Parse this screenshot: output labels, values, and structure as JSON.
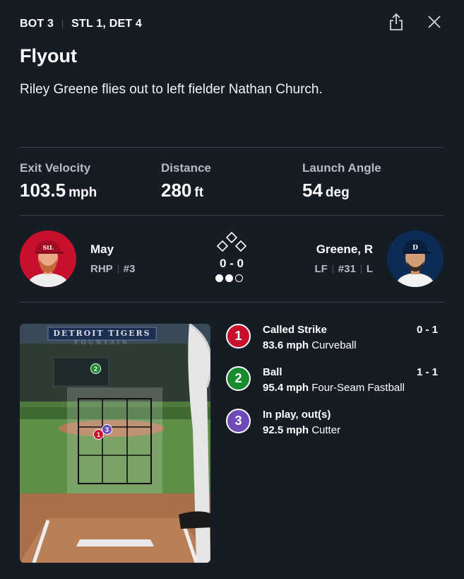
{
  "header": {
    "inning": "BOT 3",
    "score": "STL 1, DET 4",
    "title": "Flyout",
    "description": "Riley Greene flies out to left fielder Nathan Church."
  },
  "stats": [
    {
      "label": "Exit Velocity",
      "value": "103.5",
      "unit": "mph"
    },
    {
      "label": "Distance",
      "value": "280",
      "unit": "ft"
    },
    {
      "label": "Launch Angle",
      "value": "54",
      "unit": "deg"
    }
  ],
  "pitcher": {
    "name": "May",
    "position": "RHP",
    "number": "#3"
  },
  "batter": {
    "name": "Greene, R",
    "position": "LF",
    "number": "#31",
    "bats": "L"
  },
  "count": {
    "text": "0 - 0",
    "outs_recorded": 2,
    "outs_total": 3
  },
  "zone": {
    "stadium_sign": "DETROIT TIGERS",
    "stadium_sign_sub": "FOUNTAIN"
  },
  "pitches": [
    {
      "num": "1",
      "result": "Called Strike",
      "count": "0 - 1",
      "speed": "83.6 mph",
      "type": "Curveball",
      "color": "#c8102e"
    },
    {
      "num": "2",
      "result": "Ball",
      "count": "1 - 1",
      "speed": "95.4 mph",
      "type": "Four-Seam Fastball",
      "color": "#1a8a2e"
    },
    {
      "num": "3",
      "result": "In play, out(s)",
      "count": "",
      "speed": "92.5 mph",
      "type": "Cutter",
      "color": "#6f4bb8"
    }
  ],
  "colors": {
    "background": "#151c24",
    "divider": "#333e4a",
    "muted_text": "#b3bcc6"
  }
}
